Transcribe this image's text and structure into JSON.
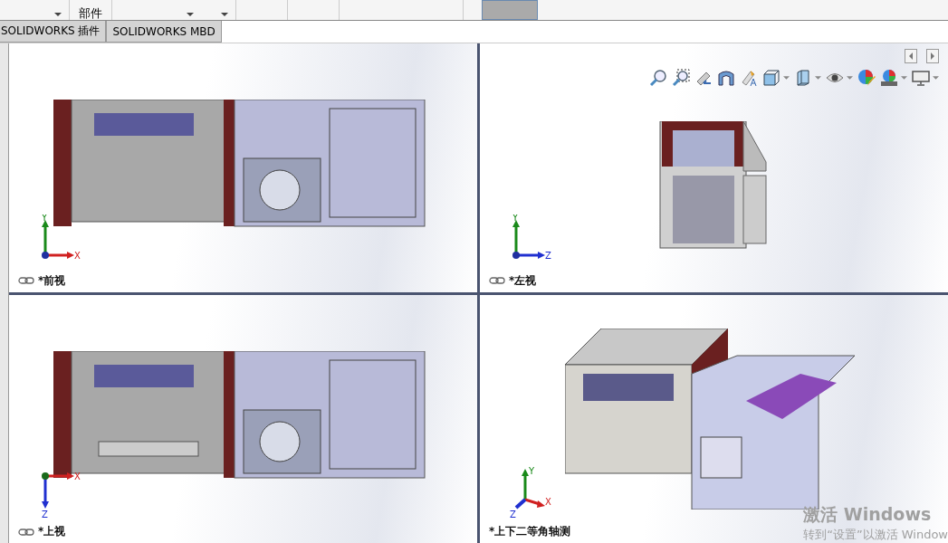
{
  "ribbon": {
    "labels": [
      "部件"
    ]
  },
  "tabs": [
    {
      "label": "SOLIDWORKS 插件"
    },
    {
      "label": "SOLIDWORKS MBD"
    }
  ],
  "viewports": [
    {
      "kind": "front",
      "label": "*前视",
      "linked": true,
      "axis_labels": [
        "Y",
        "X"
      ]
    },
    {
      "kind": "left",
      "label": "*左视",
      "linked": true,
      "axis_labels": [
        "Y",
        "Z"
      ]
    },
    {
      "kind": "top",
      "label": "*上视",
      "linked": true,
      "axis_labels": [
        "X",
        "Z"
      ]
    },
    {
      "kind": "iso",
      "label": "*上下二等角轴测",
      "linked": false,
      "axis_labels": [
        "Y",
        "X",
        "Z"
      ]
    }
  ],
  "activation": {
    "title": "激活 Windows",
    "hint": "转到“设置”以激活 Window"
  }
}
